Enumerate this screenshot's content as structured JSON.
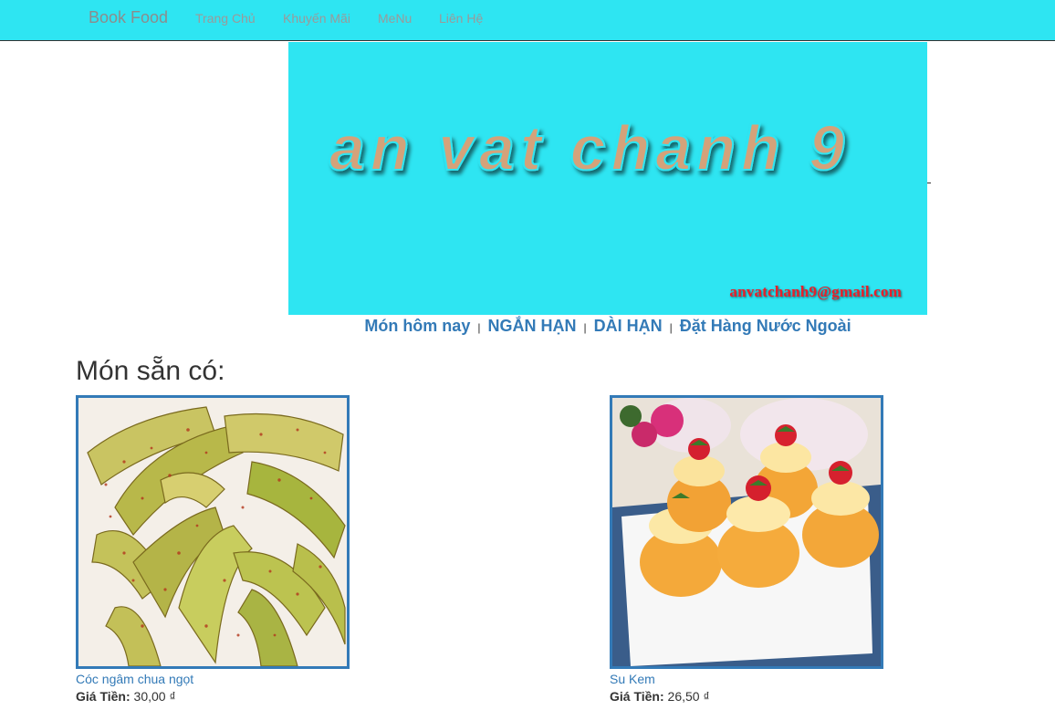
{
  "navbar": {
    "brand": "Book Food",
    "links": [
      "Trang Chủ",
      "Khuyến Mãi",
      "MeNu",
      "Liên Hệ"
    ],
    "background": "#2ee5f2"
  },
  "banner": {
    "title": "an vat chanh 9",
    "email": "anvatchanh9@gmail.com",
    "background": "#2ee5f2",
    "title_color": "#d4a27a",
    "email_color": "#e8202a"
  },
  "categories": {
    "items": [
      "Món hôm nay",
      "NGẮN HẠN",
      "DÀI HẠN",
      "Đặt Hàng Nước Ngoài"
    ],
    "separator": "|"
  },
  "section": {
    "title": "Món sẵn có:"
  },
  "products": [
    {
      "name": "Cóc ngâm chua ngọt",
      "price_label": "Giá Tiền:",
      "price": "30,00 ₫",
      "image_icon": "pickled-fruit-image"
    },
    {
      "name": "Su Kem",
      "price_label": "Giá Tiền:",
      "price": "26,50 ₫",
      "image_icon": "cream-puff-image"
    }
  ],
  "colors": {
    "link": "#337ab7",
    "thumb_border": "#337ab7"
  }
}
